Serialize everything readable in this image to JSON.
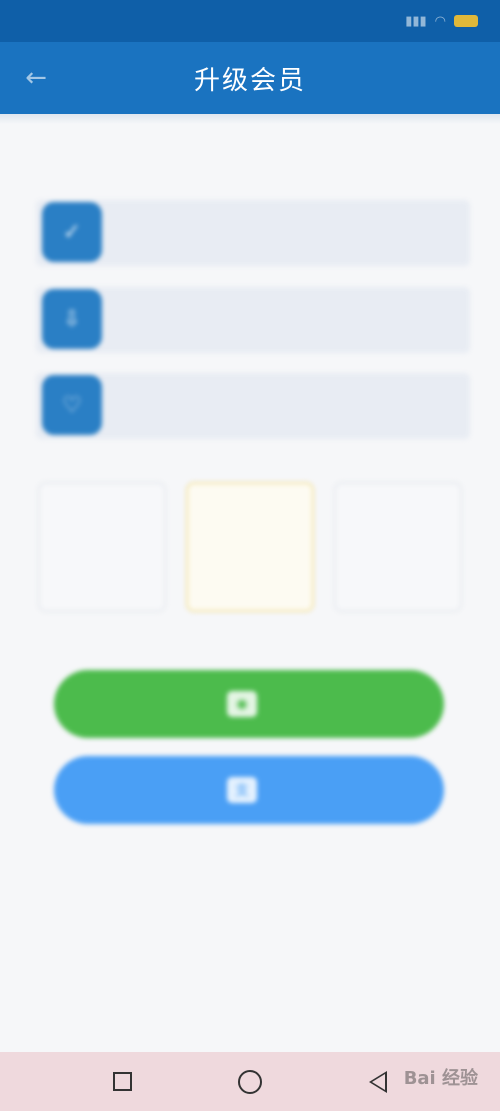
{
  "status_bar": {
    "time": "",
    "icons": [
      "signal-icon",
      "wifi-icon",
      "battery-icon"
    ]
  },
  "header": {
    "title": "升级会员",
    "back_icon": "arrow-left-icon"
  },
  "features": [
    {
      "icon": "badge-icon",
      "title": "",
      "desc": "",
      "color": "#2a7fc5"
    },
    {
      "icon": "download-icon",
      "title": "",
      "desc": "",
      "color": "#2a7fc5"
    },
    {
      "icon": "shield-icon",
      "title": "",
      "desc": "",
      "color": "#2a7fc5",
      "text_color": "#e04848"
    }
  ],
  "plans": [
    {
      "name": "",
      "price": "",
      "unit": "",
      "selected": false
    },
    {
      "name": "",
      "price": "",
      "unit": "",
      "selected": true
    },
    {
      "name": "",
      "price": "",
      "unit": "",
      "selected": false
    }
  ],
  "payment": {
    "wechat": {
      "label": "",
      "icon": "wechat-icon",
      "color": "#4cbb4c"
    },
    "alipay": {
      "label": "",
      "icon": "alipay-icon",
      "color": "#4a9ff5"
    }
  },
  "nav": {
    "recent_icon": "square-icon",
    "home_icon": "circle-icon",
    "back_icon": "triangle-back-icon"
  },
  "watermark": "Bai 经验",
  "colors": {
    "appbar": "#1a73c0",
    "statusbar": "#0f5fa8",
    "accent_gold": "#e0b53c"
  }
}
